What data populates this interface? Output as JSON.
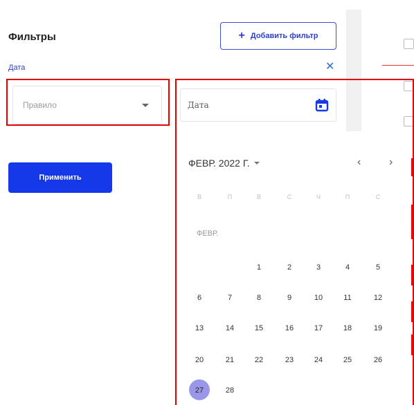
{
  "header": {
    "title": "Фильтры",
    "add_filter_label": "Добавить фильтр",
    "add_icon": "plus-icon"
  },
  "filter": {
    "label": "Дата",
    "close_icon": "close-icon",
    "rule_placeholder": "Правило",
    "date_placeholder": "Дата"
  },
  "actions": {
    "apply_label": "Применить"
  },
  "calendar": {
    "month_year": "ФЕВР. 2022 Г.",
    "prev_label": "‹",
    "next_label": "›",
    "month_short": "ФЕВР.",
    "weekdays": [
      "В",
      "П",
      "В",
      "С",
      "Ч",
      "П",
      "С"
    ],
    "weeks": [
      [
        "",
        "",
        "1",
        "2",
        "3",
        "4",
        "5"
      ],
      [
        "6",
        "7",
        "8",
        "9",
        "10",
        "11",
        "12"
      ],
      [
        "13",
        "14",
        "15",
        "16",
        "17",
        "18",
        "19"
      ],
      [
        "20",
        "21",
        "22",
        "23",
        "24",
        "25",
        "26"
      ],
      [
        "27",
        "28",
        "",
        "",
        "",
        "",
        ""
      ]
    ],
    "selected_day": "27"
  },
  "colors": {
    "accent": "#1538e8",
    "highlight": "#e60000",
    "selected_day": "#9b97e8"
  }
}
